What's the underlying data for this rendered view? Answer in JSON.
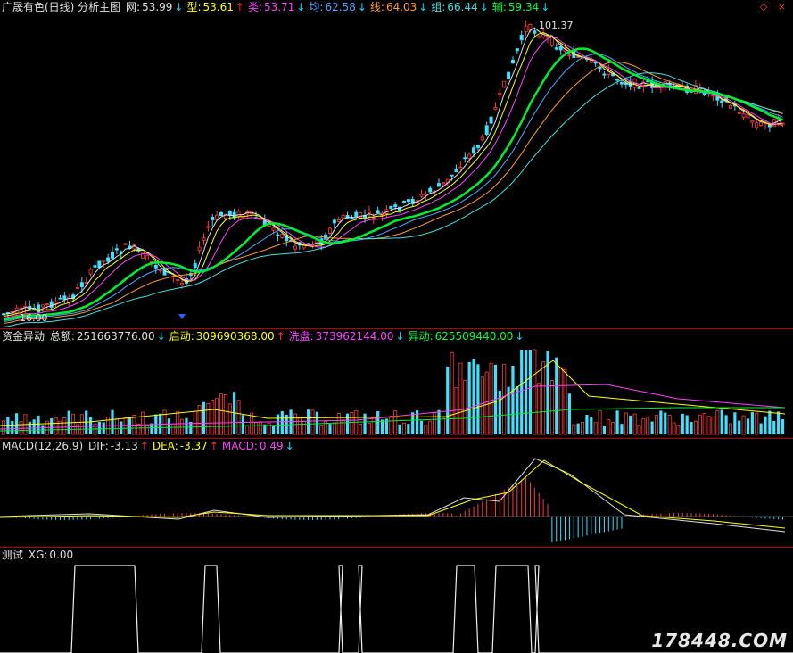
{
  "main": {
    "title": "广晟有色(日线) 分析主图",
    "indicators": [
      {
        "label": "网:",
        "value": "53.99",
        "arrow": "↓",
        "color": "#e0e0e0"
      },
      {
        "label": "型:",
        "value": "53.61",
        "arrow": "↑",
        "color": "#ffff00"
      },
      {
        "label": "类:",
        "value": "53.71",
        "arrow": "↓",
        "color": "#ff40ff"
      },
      {
        "label": "均:",
        "value": "62.58",
        "arrow": "↓",
        "color": "#4da6ff"
      },
      {
        "label": "线:",
        "value": "64.03",
        "arrow": "↓",
        "color": "#ff9933"
      },
      {
        "label": "组:",
        "value": "66.44",
        "arrow": "↓",
        "color": "#40e0e0"
      },
      {
        "label": "辅:",
        "value": "59.34",
        "arrow": "↓",
        "color": "#00ff40"
      }
    ],
    "high_label": "101.37",
    "low_label": "16.00",
    "top_icons": "◇ ×"
  },
  "fund": {
    "title": "资金异动",
    "items": [
      {
        "label": "总额:",
        "value": "251663776.00",
        "arrow": "↓",
        "color": "#e0e0e0"
      },
      {
        "label": "启动:",
        "value": "309690368.00",
        "arrow": "↑",
        "color": "#ffff00"
      },
      {
        "label": "洗盘:",
        "value": "373962144.00",
        "arrow": "↓",
        "color": "#ff40ff"
      },
      {
        "label": "异动:",
        "value": "625509440.00",
        "arrow": "↓",
        "color": "#00ff40"
      }
    ]
  },
  "macd": {
    "title": "MACD(12,26,9)",
    "items": [
      {
        "label": "DIF:",
        "value": "-3.13",
        "arrow": "↑",
        "color": "#e0e0e0"
      },
      {
        "label": "DEA:",
        "value": "-3.37",
        "arrow": "↑",
        "color": "#ffff00"
      },
      {
        "label": "MACD:",
        "value": "0.49",
        "arrow": "↓",
        "color": "#ff40ff"
      }
    ]
  },
  "test": {
    "title": "测试",
    "items": [
      {
        "label": "XG:",
        "value": "0.00",
        "arrow": "",
        "color": "#e0e0e0"
      }
    ]
  },
  "watermark": "178448.COM"
}
